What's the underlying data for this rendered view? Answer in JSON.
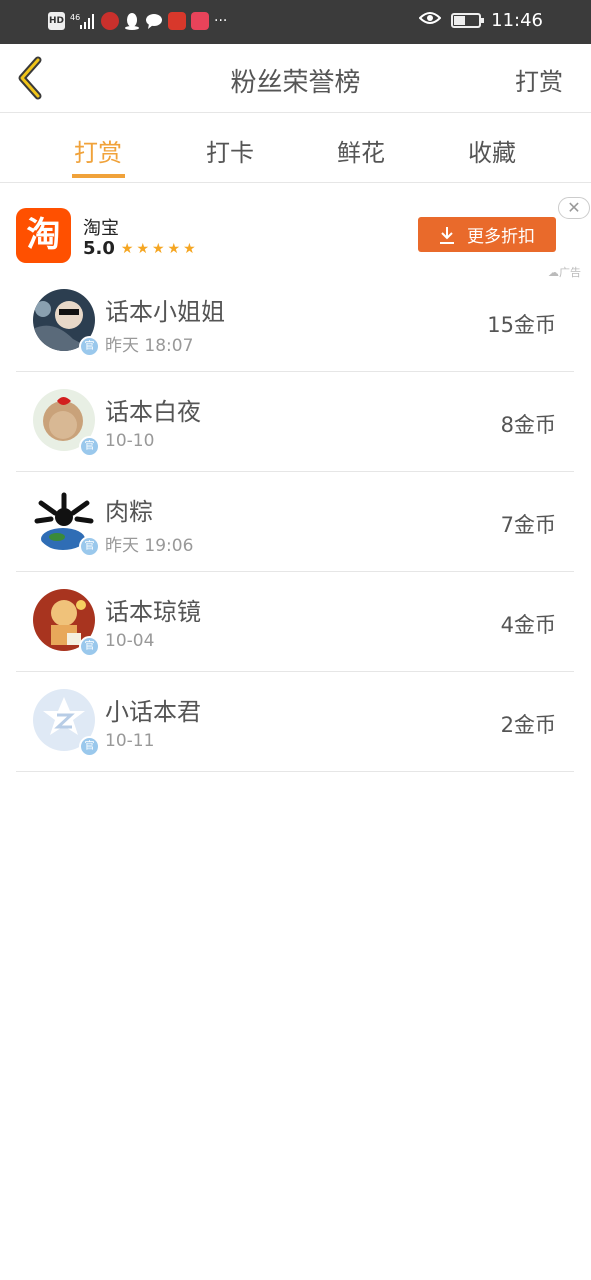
{
  "status_bar": {
    "time": "11:46",
    "icons": [
      "hd-icon",
      "4g-signal-icon",
      "app-notification-icon",
      "qq-icon",
      "message-icon",
      "app-badge-icon",
      "reader-app-icon",
      "more-dots-icon",
      "eye-icon",
      "battery-icon"
    ],
    "network": "46",
    "more": "···",
    "battery_level": 0.4
  },
  "header": {
    "title": "粉丝荣誉榜",
    "right_action": "打赏",
    "back_icon": "chevron-left-icon"
  },
  "tabs": [
    {
      "label": "打赏",
      "active": true
    },
    {
      "label": "打卡",
      "active": false
    },
    {
      "label": "鲜花",
      "active": false
    },
    {
      "label": "收藏",
      "active": false
    }
  ],
  "ad": {
    "logo_char": "淘",
    "app_name": "淘宝",
    "rating": "5.0",
    "stars": "★★★★★",
    "button_label": "更多折扣",
    "close_symbol": "✕",
    "tag": "广告",
    "accent_color": "#e96a2b"
  },
  "badge_char": "官",
  "list": [
    {
      "name": "话本小姐姐",
      "time": "昨天 18:07",
      "amount": "15金币"
    },
    {
      "name": "话本白夜",
      "time": "10-10",
      "amount": "8金币"
    },
    {
      "name": "肉粽",
      "time": "昨天 19:06",
      "amount": "7金币"
    },
    {
      "name": "话本琼镜",
      "time": "10-04",
      "amount": "4金币"
    },
    {
      "name": "小话本君",
      "time": "10-11",
      "amount": "2金币"
    }
  ],
  "colors": {
    "accent": "#f0a23a",
    "status_bar": "#3b3b3b"
  }
}
